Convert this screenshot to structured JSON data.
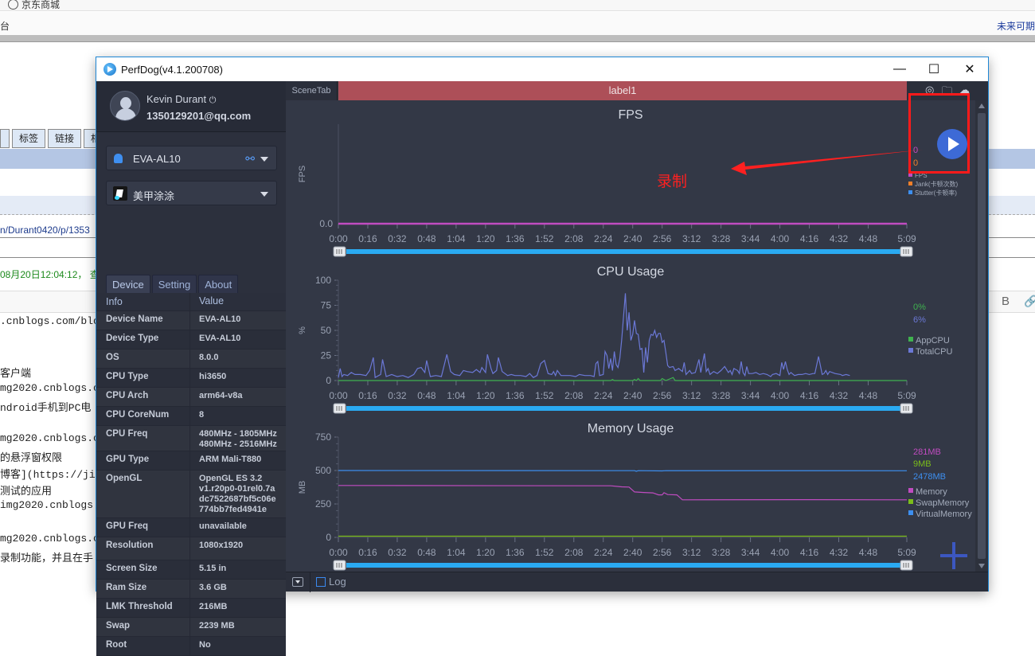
{
  "background_page": {
    "bookmark": "京东商城",
    "nav_left": "台",
    "nav_right": "未来可期",
    "tabs": [
      "标签",
      "链接",
      "相"
    ],
    "link_text": "n/Durant0420/p/1353",
    "date_text": "08月20日12:04:12， 查",
    "editor_bold": "B",
    "editor_link": "🔗",
    "lines": [
      {
        "text": ".cnblogs.com/blo",
        "mono": true
      },
      {
        "text": "客户端",
        "mono": false
      },
      {
        "text": "mg2020.cnblogs.c",
        "mono": true
      },
      {
        "text": "ndroid手机到PC电",
        "mono": true
      },
      {
        "text": "mg2020.cnblogs.c",
        "mono": true
      },
      {
        "text": "的悬浮窗权限",
        "mono": false
      },
      {
        "text": "博客](https://ji",
        "mono": true
      },
      {
        "text": "测试的应用",
        "mono": false
      },
      {
        "text": "img2020.cnblogs.",
        "mono": true
      },
      {
        "text": "mg2020.cnblogs.c",
        "mono": true
      },
      {
        "text": "录制功能，并且在手",
        "mono": false
      }
    ]
  },
  "window": {
    "title": "PerfDog(v4.1.200708)",
    "minimize": "—",
    "maximize": "☐",
    "close": "✕"
  },
  "user": {
    "name": "Kevin Durant",
    "power_icon": "⏻",
    "email": "1350129201@qq.com"
  },
  "device_select": {
    "value": "EVA-AL10"
  },
  "app_select": {
    "value": "美甲涂涂"
  },
  "tabs": [
    {
      "label": "Device",
      "active": true
    },
    {
      "label": "Setting",
      "active": false
    },
    {
      "label": "About",
      "active": false
    }
  ],
  "info_table": {
    "headers": [
      "Info",
      "Value"
    ],
    "rows": [
      {
        "key": "Device Name",
        "value": "EVA-AL10"
      },
      {
        "key": "Device Type",
        "value": "EVA-AL10"
      },
      {
        "key": "OS",
        "value": "8.0.0"
      },
      {
        "key": "CPU Type",
        "value": "hi3650"
      },
      {
        "key": "CPU Arch",
        "value": "arm64-v8a"
      },
      {
        "key": "CPU CoreNum",
        "value": "8"
      },
      {
        "key": "CPU Freq",
        "value": "480MHz - 1805MHz\n480MHz - 2516MHz"
      },
      {
        "key": "GPU Type",
        "value": "ARM Mali-T880"
      },
      {
        "key": "OpenGL",
        "value": "OpenGL ES 3.2\nv1.r20p0-01rel0.7a\ndc7522687bf5c06e\n774bb7fed4941e"
      },
      {
        "key": "GPU Freq",
        "value": "unavailable"
      },
      {
        "key": "Resolution",
        "value": "1080x1920"
      },
      {
        "key": "Screen Size",
        "value": "5.15 in"
      },
      {
        "key": "Ram Size",
        "value": "3.6 GB"
      },
      {
        "key": "LMK Threshold",
        "value": "216MB"
      },
      {
        "key": "Swap",
        "value": "2239 MB"
      },
      {
        "key": "Root",
        "value": "No"
      }
    ]
  },
  "scene_tab": {
    "label": "SceneTab",
    "scene": "label1"
  },
  "top_icons": [
    "target-icon",
    "folder-icon",
    "cloud-icon"
  ],
  "annotation": {
    "text": "录制",
    "color": "#ff2020"
  },
  "bottom": {
    "log_label": "Log",
    "log_checked": false
  },
  "chart_data": [
    {
      "type": "line",
      "title": "FPS",
      "ylabel": "FPS",
      "yticks": [
        "0.0"
      ],
      "ylim": [
        0,
        1
      ],
      "xticks": [
        "0:00",
        "0:16",
        "0:32",
        "0:48",
        "1:04",
        "1:20",
        "1:36",
        "1:52",
        "2:08",
        "2:24",
        "2:40",
        "2:56",
        "3:12",
        "3:28",
        "3:44",
        "4:00",
        "4:16",
        "4:32",
        "4:48",
        "5:09"
      ],
      "x_max_seconds": 309,
      "current_values": [
        {
          "text": "0",
          "color": "#c04cc0"
        },
        {
          "text": "0",
          "color": "#f07f2a"
        }
      ],
      "series": [
        {
          "name": "FPS",
          "color": "#c04cc0",
          "points": [
            [
              0,
              0
            ],
            [
              309,
              0
            ]
          ]
        },
        {
          "name": "Jank(卡顿次数)",
          "color": "#f07f2a",
          "points": []
        },
        {
          "name": "Stutter(卡顿率)",
          "color": "#3d8ff0",
          "points": []
        }
      ]
    },
    {
      "type": "line",
      "title": "CPU Usage",
      "ylabel": "%",
      "yticks": [
        "0",
        "25",
        "50",
        "75",
        "100"
      ],
      "ylim": [
        0,
        100
      ],
      "xticks": [
        "0:00",
        "0:16",
        "0:32",
        "0:48",
        "1:04",
        "1:20",
        "1:36",
        "1:52",
        "2:08",
        "2:24",
        "2:40",
        "2:56",
        "3:12",
        "3:28",
        "3:44",
        "4:00",
        "4:16",
        "4:32",
        "4:48",
        "5:09"
      ],
      "x_max_seconds": 309,
      "current_values": [
        {
          "text": "0%",
          "color": "#3fb24f"
        },
        {
          "text": "6%",
          "color": "#6b78d6"
        }
      ],
      "series": [
        {
          "name": "AppCPU",
          "color": "#3fb24f",
          "points": [
            [
              0,
              0
            ],
            [
              148,
              0
            ],
            [
              149,
              1
            ],
            [
              150,
              0
            ],
            [
              160,
              0
            ],
            [
              161,
              1
            ],
            [
              162,
              0
            ],
            [
              163,
              2
            ],
            [
              164,
              0
            ],
            [
              175,
              0
            ],
            [
              176,
              2
            ],
            [
              178,
              0
            ],
            [
              182,
              3
            ],
            [
              183,
              0
            ],
            [
              309,
              0
            ]
          ]
        },
        {
          "name": "TotalCPU",
          "color": "#6b78d6",
          "points": [
            [
              0,
              3
            ],
            [
              1,
              12
            ],
            [
              2,
              4
            ],
            [
              3,
              6
            ],
            [
              5,
              5
            ],
            [
              7,
              8
            ],
            [
              9,
              6
            ],
            [
              12,
              6
            ],
            [
              15,
              5
            ],
            [
              17,
              10
            ],
            [
              19,
              23
            ],
            [
              20,
              3
            ],
            [
              23,
              6
            ],
            [
              24,
              21
            ],
            [
              26,
              4
            ],
            [
              29,
              6
            ],
            [
              32,
              4
            ],
            [
              35,
              5
            ],
            [
              38,
              3
            ],
            [
              41,
              6
            ],
            [
              43,
              12
            ],
            [
              45,
              13
            ],
            [
              47,
              8
            ],
            [
              48,
              20
            ],
            [
              50,
              4
            ],
            [
              53,
              5
            ],
            [
              56,
              4
            ],
            [
              59,
              26
            ],
            [
              61,
              9
            ],
            [
              63,
              6
            ],
            [
              66,
              5
            ],
            [
              68,
              10
            ],
            [
              70,
              9
            ],
            [
              73,
              8
            ],
            [
              75,
              11
            ],
            [
              77,
              8
            ],
            [
              78,
              13
            ],
            [
              80,
              8
            ],
            [
              81,
              26
            ],
            [
              83,
              12
            ],
            [
              84,
              7
            ],
            [
              86,
              10
            ],
            [
              87,
              23
            ],
            [
              89,
              9
            ],
            [
              92,
              5
            ],
            [
              94,
              6
            ],
            [
              96,
              5
            ],
            [
              99,
              5
            ],
            [
              102,
              4
            ],
            [
              104,
              7
            ],
            [
              106,
              3
            ],
            [
              108,
              5
            ],
            [
              110,
              17
            ],
            [
              112,
              20
            ],
            [
              114,
              7
            ],
            [
              116,
              6
            ],
            [
              117,
              9
            ],
            [
              118,
              5
            ],
            [
              119,
              10
            ],
            [
              121,
              5
            ],
            [
              126,
              5
            ],
            [
              129,
              4
            ],
            [
              131,
              6
            ],
            [
              134,
              5
            ],
            [
              137,
              5
            ],
            [
              139,
              4
            ],
            [
              140,
              17
            ],
            [
              141,
              19
            ],
            [
              142,
              5
            ],
            [
              144,
              6
            ],
            [
              145,
              29
            ],
            [
              146,
              25
            ],
            [
              147,
              12
            ],
            [
              148,
              22
            ],
            [
              149,
              10
            ],
            [
              150,
              29
            ],
            [
              151,
              16
            ],
            [
              152,
              13
            ],
            [
              153,
              22
            ],
            [
              154,
              40
            ],
            [
              156,
              87
            ],
            [
              157,
              50
            ],
            [
              158,
              68
            ],
            [
              159,
              40
            ],
            [
              160,
              46
            ],
            [
              161,
              60
            ],
            [
              162,
              47
            ],
            [
              163,
              46
            ],
            [
              164,
              31
            ],
            [
              165,
              32
            ],
            [
              166,
              8
            ],
            [
              167,
              33
            ],
            [
              168,
              18
            ],
            [
              169,
              40
            ],
            [
              170,
              46
            ],
            [
              171,
              45
            ],
            [
              172,
              50
            ],
            [
              173,
              43
            ],
            [
              174,
              47
            ],
            [
              175,
              47
            ],
            [
              176,
              38
            ],
            [
              177,
              40
            ],
            [
              178,
              28
            ],
            [
              179,
              15
            ],
            [
              180,
              13
            ],
            [
              182,
              14
            ],
            [
              183,
              10
            ],
            [
              185,
              12
            ],
            [
              187,
              9
            ],
            [
              188,
              18
            ],
            [
              189,
              6
            ],
            [
              191,
              10
            ],
            [
              192,
              7
            ],
            [
              194,
              8
            ],
            [
              196,
              21
            ],
            [
              197,
              8
            ],
            [
              199,
              27
            ],
            [
              200,
              9
            ],
            [
              201,
              12
            ],
            [
              202,
              6
            ],
            [
              204,
              9
            ],
            [
              206,
              7
            ],
            [
              208,
              10
            ],
            [
              210,
              14
            ],
            [
              212,
              8
            ],
            [
              213,
              10
            ],
            [
              214,
              6
            ],
            [
              215,
              12
            ],
            [
              217,
              10
            ],
            [
              218,
              7
            ],
            [
              219,
              19
            ],
            [
              220,
              8
            ],
            [
              221,
              5
            ],
            [
              222,
              14
            ],
            [
              223,
              7
            ],
            [
              225,
              7
            ],
            [
              227,
              8
            ],
            [
              229,
              6
            ],
            [
              231,
              7
            ],
            [
              233,
              6
            ],
            [
              235,
              4
            ],
            [
              236,
              6
            ],
            [
              238,
              7
            ],
            [
              240,
              5
            ],
            [
              241,
              18
            ],
            [
              242,
              11
            ],
            [
              243,
              19
            ],
            [
              244,
              11
            ],
            [
              245,
              6
            ],
            [
              246,
              8
            ],
            [
              248,
              5
            ],
            [
              250,
              6
            ],
            [
              252,
              6
            ],
            [
              254,
              7
            ],
            [
              256,
              6
            ],
            [
              258,
              7
            ],
            [
              259,
              7
            ],
            [
              261,
              24
            ],
            [
              263,
              6
            ],
            [
              264,
              7
            ],
            [
              265,
              10
            ],
            [
              266,
              6
            ],
            [
              267,
              9
            ],
            [
              270,
              7
            ],
            [
              273,
              6
            ],
            [
              274,
              5
            ],
            [
              276,
              6
            ],
            [
              278,
              5
            ]
          ]
        }
      ]
    },
    {
      "type": "line",
      "title": "Memory Usage",
      "ylabel": "MB",
      "yticks": [
        "0",
        "250",
        "500",
        "750"
      ],
      "ylim": [
        0,
        750
      ],
      "xticks": [
        "0:00",
        "0:16",
        "0:32",
        "0:48",
        "1:04",
        "1:20",
        "1:36",
        "1:52",
        "2:08",
        "2:24",
        "2:40",
        "2:56",
        "3:12",
        "3:28",
        "3:44",
        "4:00",
        "4:16",
        "4:32",
        "4:48",
        "5:09"
      ],
      "x_max_seconds": 309,
      "current_values": [
        {
          "text": "281MB",
          "color": "#c04cc0"
        },
        {
          "text": "9MB",
          "color": "#7bbd1a"
        },
        {
          "text": "2478MB",
          "color": "#3d8ff0"
        }
      ],
      "series": [
        {
          "name": "Memory",
          "color": "#c04cc0",
          "points": [
            [
              0,
              388
            ],
            [
              148,
              386
            ],
            [
              154,
              378
            ],
            [
              158,
              376
            ],
            [
              161,
              340
            ],
            [
              166,
              336
            ],
            [
              171,
              333
            ],
            [
              174,
              318
            ],
            [
              176,
              318
            ],
            [
              177,
              334
            ],
            [
              179,
              320
            ],
            [
              184,
              318
            ],
            [
              187,
              281
            ],
            [
              250,
              282
            ],
            [
              309,
              281
            ]
          ]
        },
        {
          "name": "SwapMemory",
          "color": "#7bbd1a",
          "points": [
            [
              0,
              9
            ],
            [
              309,
              9
            ]
          ]
        },
        {
          "name": "VirtualMemory",
          "color": "#3d8ff0",
          "points": [
            [
              0,
              500
            ],
            [
              161,
              499
            ],
            [
              162,
              494
            ],
            [
              163,
              499
            ],
            [
              176,
              497
            ],
            [
              178,
              499
            ],
            [
              309,
              498
            ]
          ]
        }
      ]
    }
  ]
}
